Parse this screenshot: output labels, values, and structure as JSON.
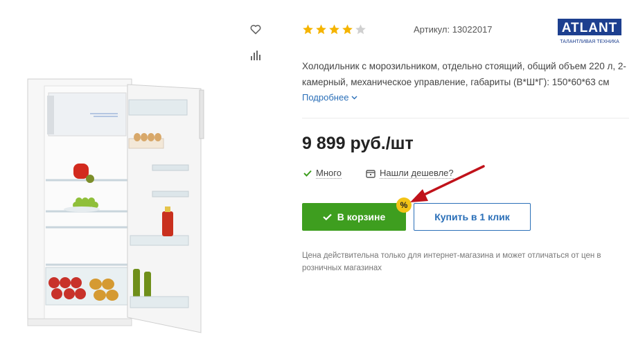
{
  "product": {
    "rating": {
      "value": 4,
      "max": 5
    },
    "article_label": "Артикул: 13022017",
    "description": "Холодильник с морозильником, отдельно стоящий, общий объем 220 л, 2-камерный, механическое управление, габариты (В*Ш*Г): 150*60*63 см",
    "more_label": "Подробнее",
    "price": "9 899 руб./шт",
    "stock_label": "Много",
    "cheaper_label": "Нашли дешевле?",
    "cart_button_label": "В корзине",
    "discount_badge": "%",
    "one_click_label": "Купить в 1 клик",
    "price_note": "Цена действительна только для интернет-магазина и может отличаться от цен в розничных магазинах"
  },
  "brand": {
    "name": "ATLANT",
    "tagline": "ТАЛАНТЛИВАЯ ТЕХНИКА"
  },
  "icons": {
    "favorite": "heart-icon",
    "compare": "bar-chart-icon",
    "stock": "check-icon",
    "cheaper": "tag-icon",
    "cart": "check-icon",
    "more": "chevron-down-icon"
  },
  "colors": {
    "accent_green": "#3e9e1f",
    "link_blue": "#2a6fb8",
    "star": "#f5b400",
    "star_empty": "#d0d0d0",
    "badge": "#f3c316",
    "annotation": "#c0121a",
    "brand_blue": "#1d3f8f"
  }
}
